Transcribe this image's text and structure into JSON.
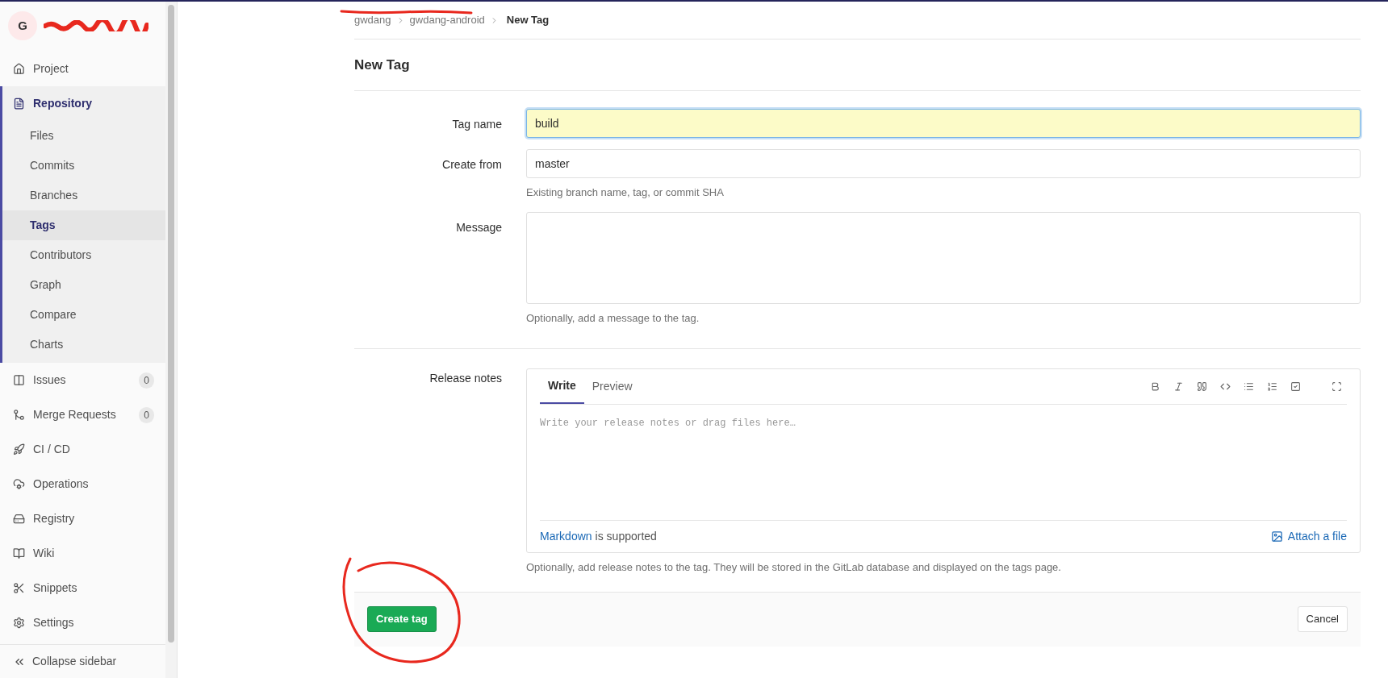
{
  "sidebar": {
    "avatar": "G",
    "items": [
      {
        "label": "Project",
        "selected": false
      },
      {
        "label": "Repository",
        "selected": true,
        "children": [
          {
            "label": "Files",
            "selected": false
          },
          {
            "label": "Commits",
            "selected": false
          },
          {
            "label": "Branches",
            "selected": false
          },
          {
            "label": "Tags",
            "selected": true
          },
          {
            "label": "Contributors",
            "selected": false
          },
          {
            "label": "Graph",
            "selected": false
          },
          {
            "label": "Compare",
            "selected": false
          },
          {
            "label": "Charts",
            "selected": false
          }
        ]
      },
      {
        "label": "Issues",
        "selected": false,
        "count": "0"
      },
      {
        "label": "Merge Requests",
        "selected": false,
        "count": "0"
      },
      {
        "label": "CI / CD",
        "selected": false
      },
      {
        "label": "Operations",
        "selected": false
      },
      {
        "label": "Registry",
        "selected": false
      },
      {
        "label": "Wiki",
        "selected": false
      },
      {
        "label": "Snippets",
        "selected": false
      },
      {
        "label": "Settings",
        "selected": false
      }
    ],
    "collapse": "Collapse sidebar"
  },
  "breadcrumbs": [
    "gwdang",
    "gwdang-android",
    "New Tag"
  ],
  "title": "New Tag",
  "fields": [
    {
      "kind": "input",
      "label": "Tag name",
      "value": "build",
      "highlighted": true
    },
    {
      "kind": "input",
      "label": "Create from",
      "value": "master",
      "highlighted": false,
      "help": "Existing branch name, tag, or commit SHA"
    },
    {
      "kind": "textarea",
      "label": "Message",
      "help": "Optionally, add a message to the tag."
    }
  ],
  "release_notes": {
    "label": "Release notes",
    "tabs": [
      {
        "label": "Write",
        "selected": true
      },
      {
        "label": "Preview",
        "selected": false
      }
    ],
    "placeholder": "Write your release notes or drag files here…",
    "markdown_link": "Markdown",
    "markdown_text": "is supported",
    "attach": "Attach a file",
    "help": "Optionally, add release notes to the tag. They will be stored in the GitLab database and displayed on the tags page."
  },
  "buttons": [
    {
      "label": "Create tag",
      "kind": "primary"
    },
    {
      "label": "Cancel",
      "kind": "default"
    }
  ]
}
